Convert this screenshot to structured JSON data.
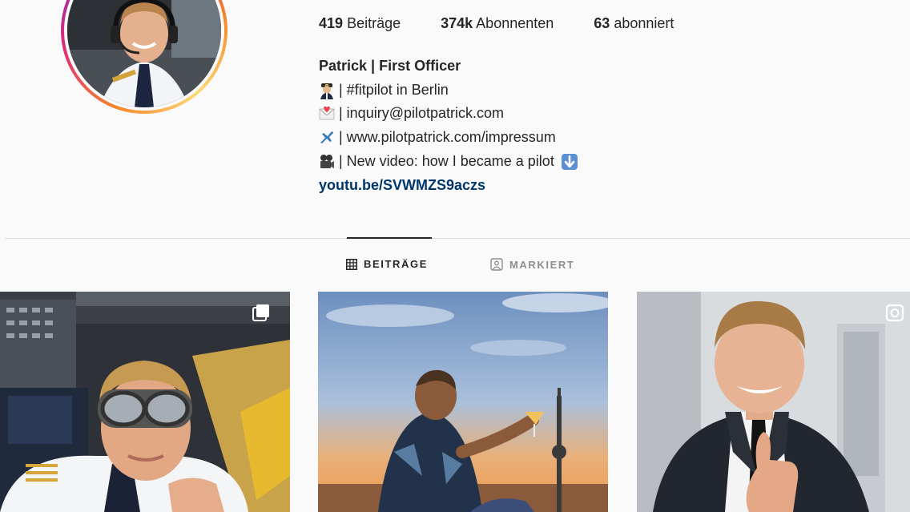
{
  "profile": {
    "stats": {
      "posts_count": "419",
      "posts_label": "Beiträge",
      "followers_count": "374k",
      "followers_label": "Abonnenten",
      "following_count": "63",
      "following_label": "abonniert"
    },
    "bio": {
      "name": "Patrick | First Officer",
      "line1": "| #fitpilot in Berlin",
      "line2": "| inquiry@pilotpatrick.com",
      "line3": "| www.pilotpatrick.com/impressum",
      "line4": "| New video: how I became a pilot",
      "link": "youtu.be/SVWMZS9aczs"
    }
  },
  "tabs": [
    {
      "label": "BEITRÄGE",
      "icon": "grid-icon",
      "active": true
    },
    {
      "label": "MARKIERT",
      "icon": "tagged-icon",
      "active": false
    }
  ],
  "posts": [
    {
      "icon": "carousel-icon"
    },
    {
      "icon": null
    },
    {
      "icon": "igtv-icon"
    }
  ]
}
